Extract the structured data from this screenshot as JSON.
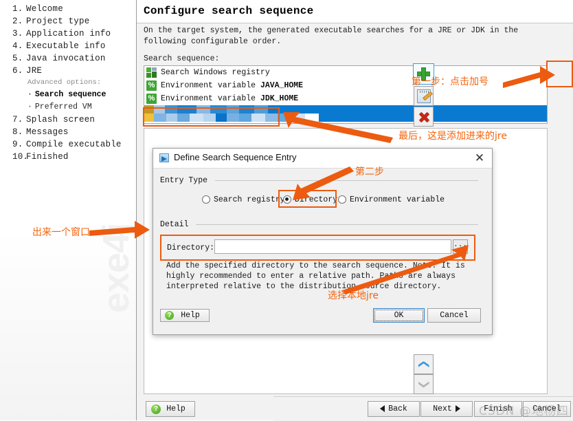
{
  "sidebar": {
    "steps": [
      {
        "num": "1.",
        "label": "Welcome"
      },
      {
        "num": "2.",
        "label": "Project type"
      },
      {
        "num": "3.",
        "label": "Application info"
      },
      {
        "num": "4.",
        "label": "Executable info"
      },
      {
        "num": "5.",
        "label": "Java invocation"
      },
      {
        "num": "6.",
        "label": "JRE"
      }
    ],
    "advanced_label": "Advanced options:",
    "sub_items": [
      {
        "label": "Search sequence",
        "current": true
      },
      {
        "label": "Preferred VM",
        "current": false
      }
    ],
    "steps_after": [
      {
        "num": "7.",
        "label": "Splash screen"
      },
      {
        "num": "8.",
        "label": "Messages"
      },
      {
        "num": "9.",
        "label": "Compile executable"
      },
      {
        "num": "10.",
        "label": "Finished"
      }
    ],
    "watermark": "exe4j"
  },
  "main": {
    "title": "Configure search sequence",
    "description": "On the target system, the generated executable searches for a JRE or JDK in the following configurable order.",
    "sequence_label": "Search sequence:",
    "sequence_items": [
      {
        "icon": "registry-icon",
        "text": "Search Windows registry",
        "bold": "",
        "selected": false
      },
      {
        "icon": "percent-icon",
        "text": "Environment variable ",
        "bold": "JAVA_HOME",
        "selected": false
      },
      {
        "icon": "percent-icon",
        "text": "Environment variable ",
        "bold": "JDK_HOME",
        "selected": false
      },
      {
        "icon": "directory-icon",
        "text": "",
        "bold": "",
        "selected": true,
        "redacted": true
      }
    ],
    "tool_buttons": [
      {
        "name": "add",
        "icon": "plus-icon",
        "tooltip": "Add"
      },
      {
        "name": "edit",
        "icon": "pencil-icon",
        "tooltip": "Edit"
      },
      {
        "name": "delete",
        "icon": "x-icon",
        "tooltip": "Remove"
      },
      {
        "name": "move-up",
        "icon": "chevron-up-icon",
        "tooltip": "Move up"
      },
      {
        "name": "move-down",
        "icon": "chevron-down-icon",
        "tooltip": "Move down"
      }
    ]
  },
  "dialog": {
    "title": "Define Search Sequence Entry",
    "close_label": "✕",
    "entry_type_legend": "Entry Type",
    "entry_type_options": [
      {
        "label": "Search registry",
        "selected": false
      },
      {
        "label": "Directory",
        "selected": true
      },
      {
        "label": "Environment variable",
        "selected": false
      }
    ],
    "detail_legend": "Detail",
    "directory_label": "Directory:",
    "directory_value": "",
    "directory_placeholder": "",
    "browse_label": "...",
    "hint": "Add the specified directory to the search sequence. Note: It is highly recommended to enter a relative path. Paths are always interpreted relative to the distribution source directory.",
    "help_label": "Help",
    "help_icon": "?",
    "ok_label": "OK",
    "cancel_label": "Cancel"
  },
  "nav": {
    "help_label": "Help",
    "help_icon": "?",
    "back_label": "Back",
    "next_label": "Next",
    "finish_label": "Finish",
    "cancel_label": "Cancel"
  },
  "annotations": {
    "step1": "第一步：点击加号",
    "last": "最后，这是添加进来的jre",
    "window": "出来一个窗口",
    "step2": "第二步",
    "choose_jre": "选择本地jre"
  },
  "watermark": {
    "csdn": "CSDN @地杨四"
  },
  "colors": {
    "accent_orange": "#ec5b10",
    "selection_blue": "#0a7ad1",
    "green": "#3fa535",
    "red": "#c0271a"
  }
}
